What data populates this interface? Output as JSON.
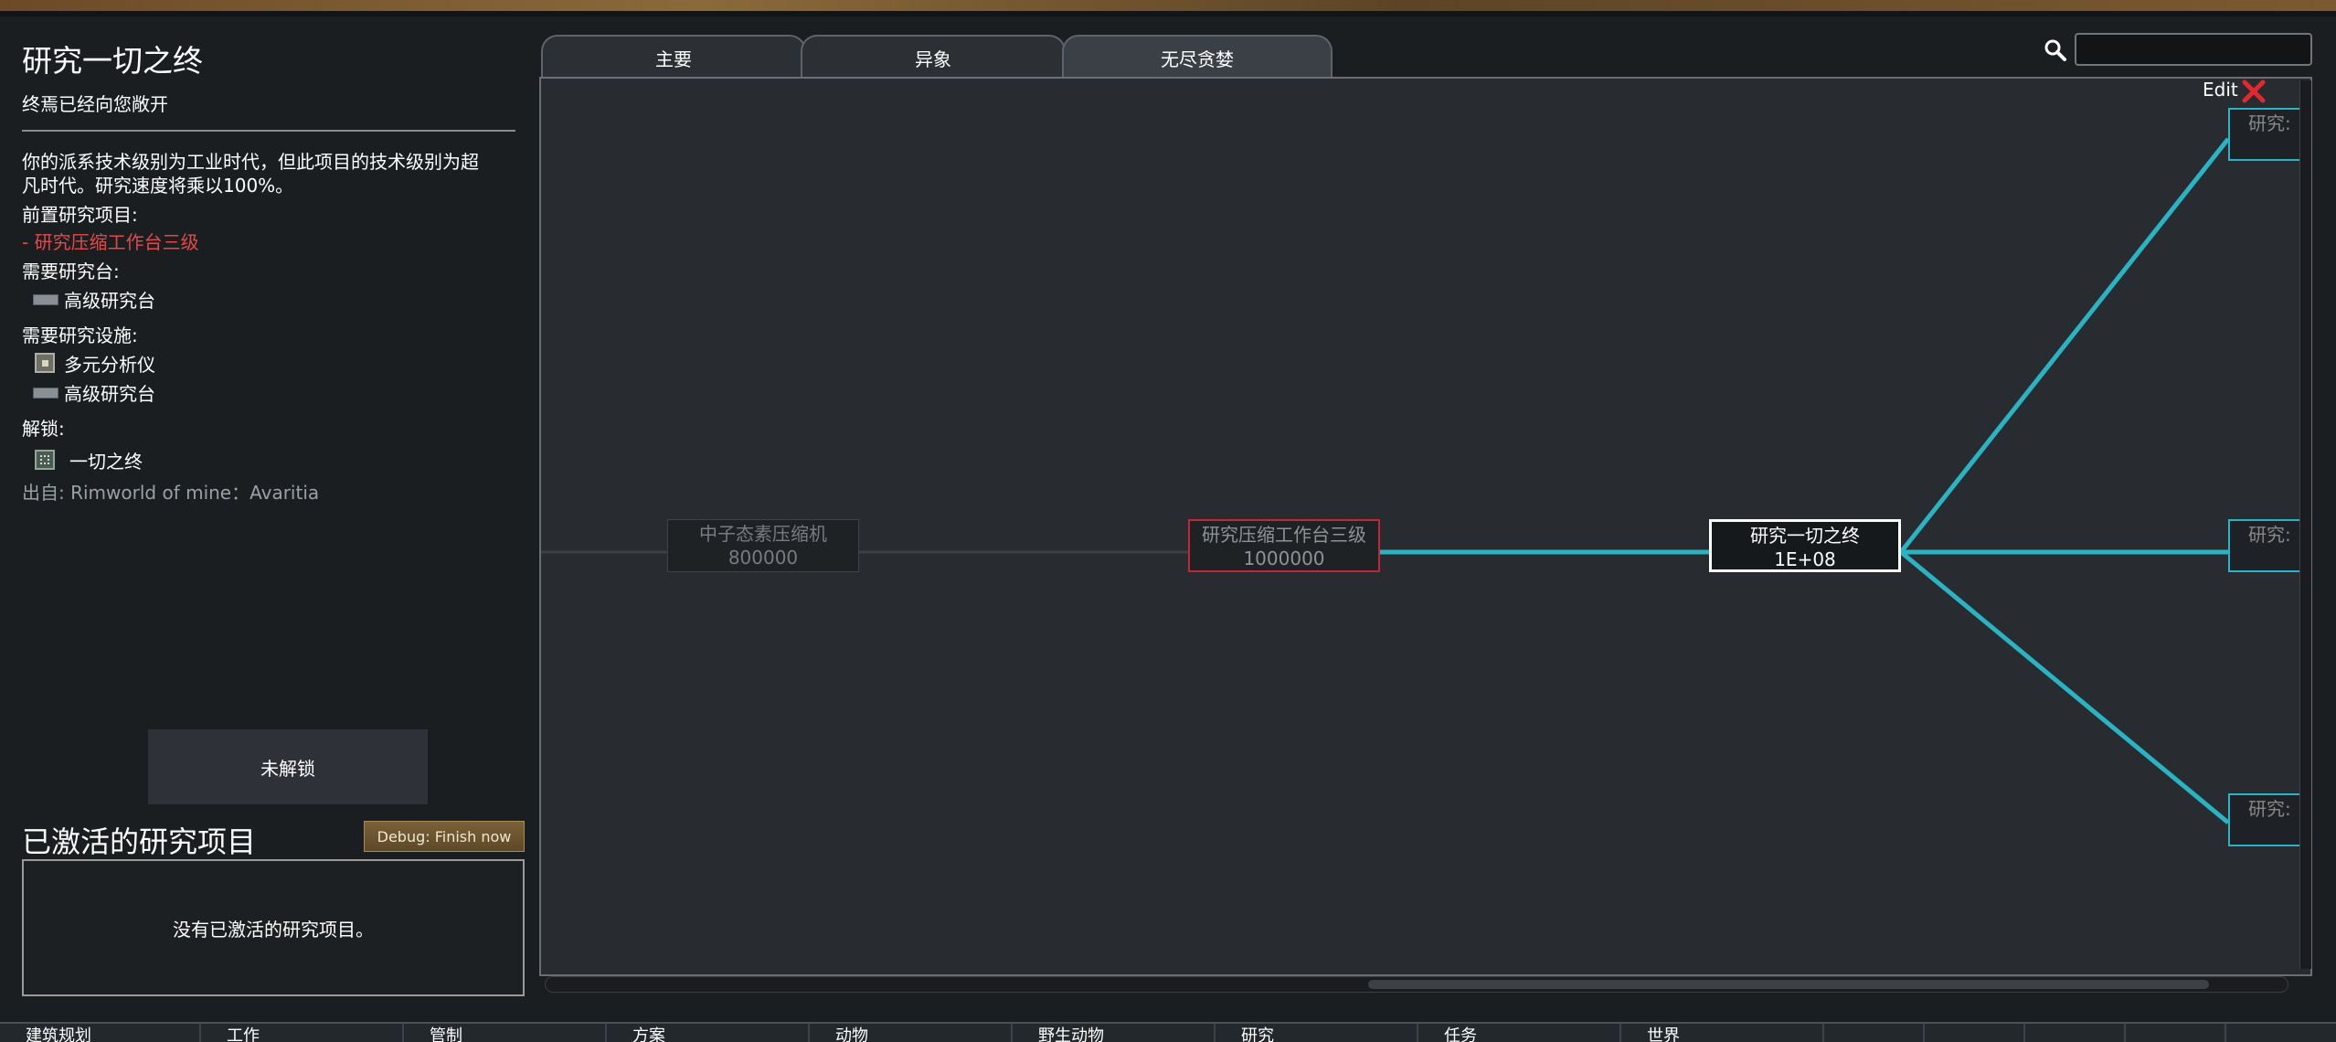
{
  "sidebar": {
    "title": "研究一切之终",
    "subtitle": "终焉已经向您敞开",
    "description_line1": "你的派系技术级别为工业时代，但此项目的技术级别为超",
    "description_line2": "凡时代。研究速度将乘以100%。",
    "prereq_header": "前置研究项目:",
    "prereq_item": " - 研究压缩工作台三级",
    "bench_header": "需要研究台:",
    "bench_item": "高级研究台",
    "facility_header": "需要研究设施:",
    "facility_items": [
      "多元分析仪",
      "高级研究台"
    ],
    "unlock_header": "解锁:",
    "unlock_item": "一切之终",
    "source": "出自:  Rimworld of mine：Avaritia",
    "unlock_button": "未解锁",
    "active_title": "已激活的研究项目",
    "debug_button": "Debug: Finish now",
    "active_empty": "没有已激活的研究项目。"
  },
  "tabs": [
    {
      "label": "主要",
      "selected": false
    },
    {
      "label": "异象",
      "selected": false
    },
    {
      "label": "无尽贪婪",
      "selected": true
    }
  ],
  "search": {
    "value": ""
  },
  "tree": {
    "edit_label": "Edit",
    "nodes": [
      {
        "name": "中子态素压缩机",
        "cost": "800000",
        "state": "locked"
      },
      {
        "name": "研究压缩工作台三级",
        "cost": "1000000",
        "state": "missing-prereq"
      },
      {
        "name": "研究一切之终",
        "cost": "1E+08",
        "state": "selected"
      },
      {
        "name": "研究:",
        "cost": "",
        "state": "partial"
      },
      {
        "name": "研究:",
        "cost": "",
        "state": "partial"
      },
      {
        "name": "研究:",
        "cost": "",
        "state": "partial"
      }
    ],
    "link_color": "#2ab3c2"
  },
  "bottom_bar": {
    "tabs": [
      "建筑规划",
      "工作",
      "管制",
      "方案",
      "动物",
      "野生动物",
      "研究",
      "任务",
      "世界"
    ]
  }
}
